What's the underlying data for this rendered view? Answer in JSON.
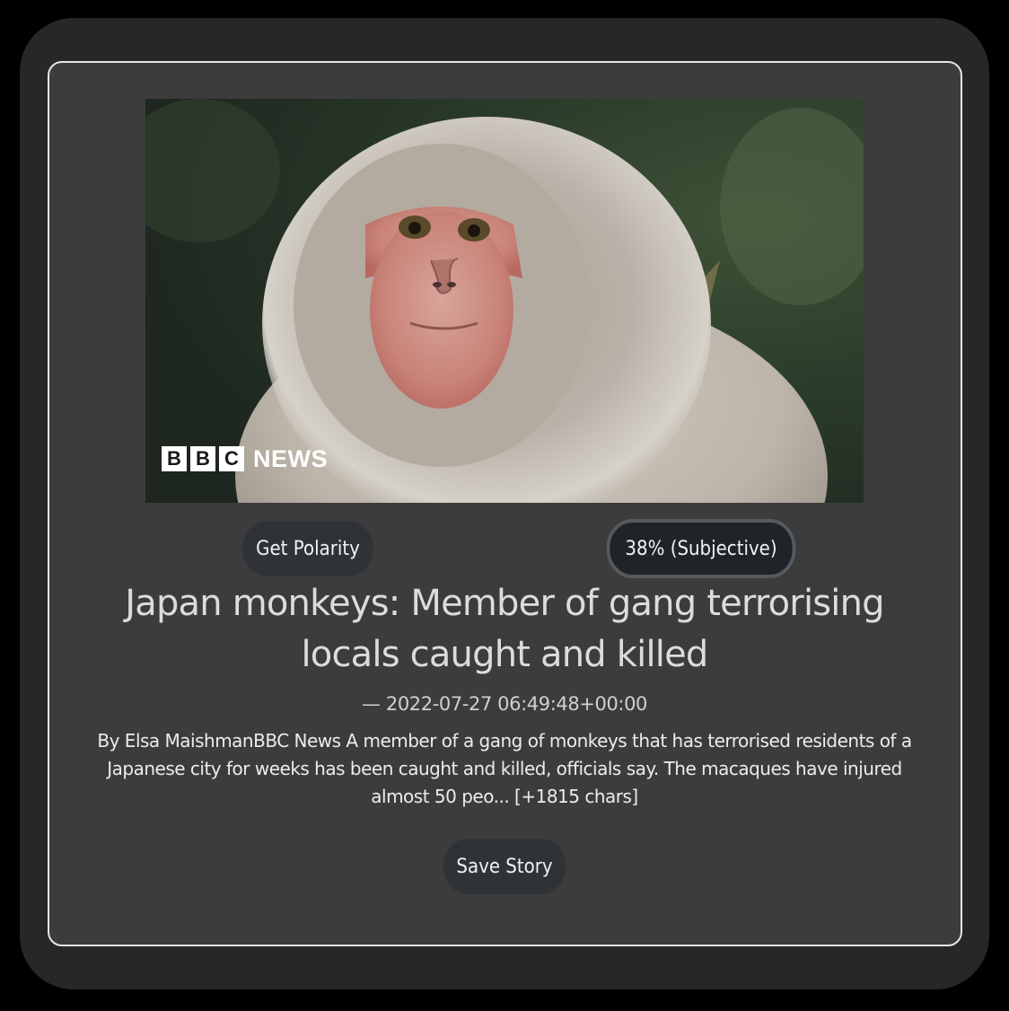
{
  "article": {
    "image_alt": "Japanese macaque",
    "logo": {
      "letters": [
        "B",
        "B",
        "C"
      ],
      "word": "NEWS"
    },
    "polarity_button_label": "Get Polarity",
    "polarity_result": "38% (Subjective)",
    "headline": "Japan monkeys: Member of gang terrorising locals caught and killed",
    "published": "— 2022-07-27 06:49:48+00:00",
    "summary": "By Elsa MaishmanBBC News A member of a gang of monkeys that has terrorised residents of a Japanese city for weeks has been caught and killed, officials say. The macaques have injured almost 50 peo... [+1815 chars]",
    "save_button_label": "Save Story"
  }
}
